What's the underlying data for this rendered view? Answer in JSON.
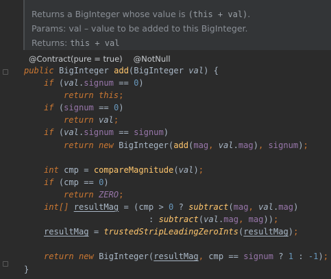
{
  "doc": {
    "summary_prefix": "Returns a BigInteger whose value is ",
    "summary_code": "(this + val)",
    "summary_suffix": ".",
    "params_label": "Params:",
    "params_text": "val – value to be added to this BigInteger.",
    "returns_label": "Returns:",
    "returns_code": "this + val"
  },
  "hints": {
    "contract": "@Contract(pure = true)",
    "notnull": "@NotNull"
  },
  "code": {
    "kw_public": "public",
    "kw_if": "if",
    "kw_return": "return",
    "kw_new": "new",
    "kw_this": "this",
    "kw_int": "int",
    "type_biginteger": "BigInteger",
    "type_int_array": "int[]",
    "fn_add": "add",
    "fn_compareMagnitude": "compareMagnitude",
    "fn_subtract": "subtract",
    "fn_trustedStrip": "trustedStripLeadingZeroInts",
    "param_val": "val",
    "field_signum": "signum",
    "field_mag": "mag",
    "const_zero": "ZERO",
    "local_cmp": "cmp",
    "local_resultMag": "resultMag",
    "num_0": "0",
    "num_1": "1",
    "num_neg1": "-1"
  }
}
